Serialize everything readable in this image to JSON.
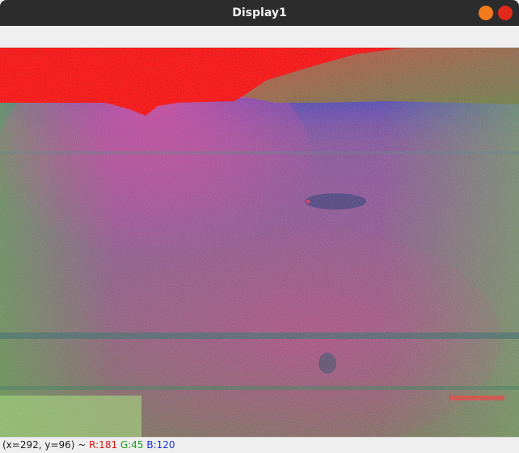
{
  "window": {
    "title": "Display1"
  },
  "status": {
    "coords": "(x=292, y=96) ~ ",
    "r": "R:181",
    "g": "G:45",
    "b": "B:120"
  },
  "colors": {
    "titlebar": "#2c2c2c",
    "minimize": "#f37b1d",
    "close": "#e0291b",
    "red_value": "#e01010",
    "green_value": "#1a9a1a",
    "blue_value": "#1c30d8"
  },
  "icons": {
    "minimize": "minimize-icon",
    "close": "close-icon"
  }
}
